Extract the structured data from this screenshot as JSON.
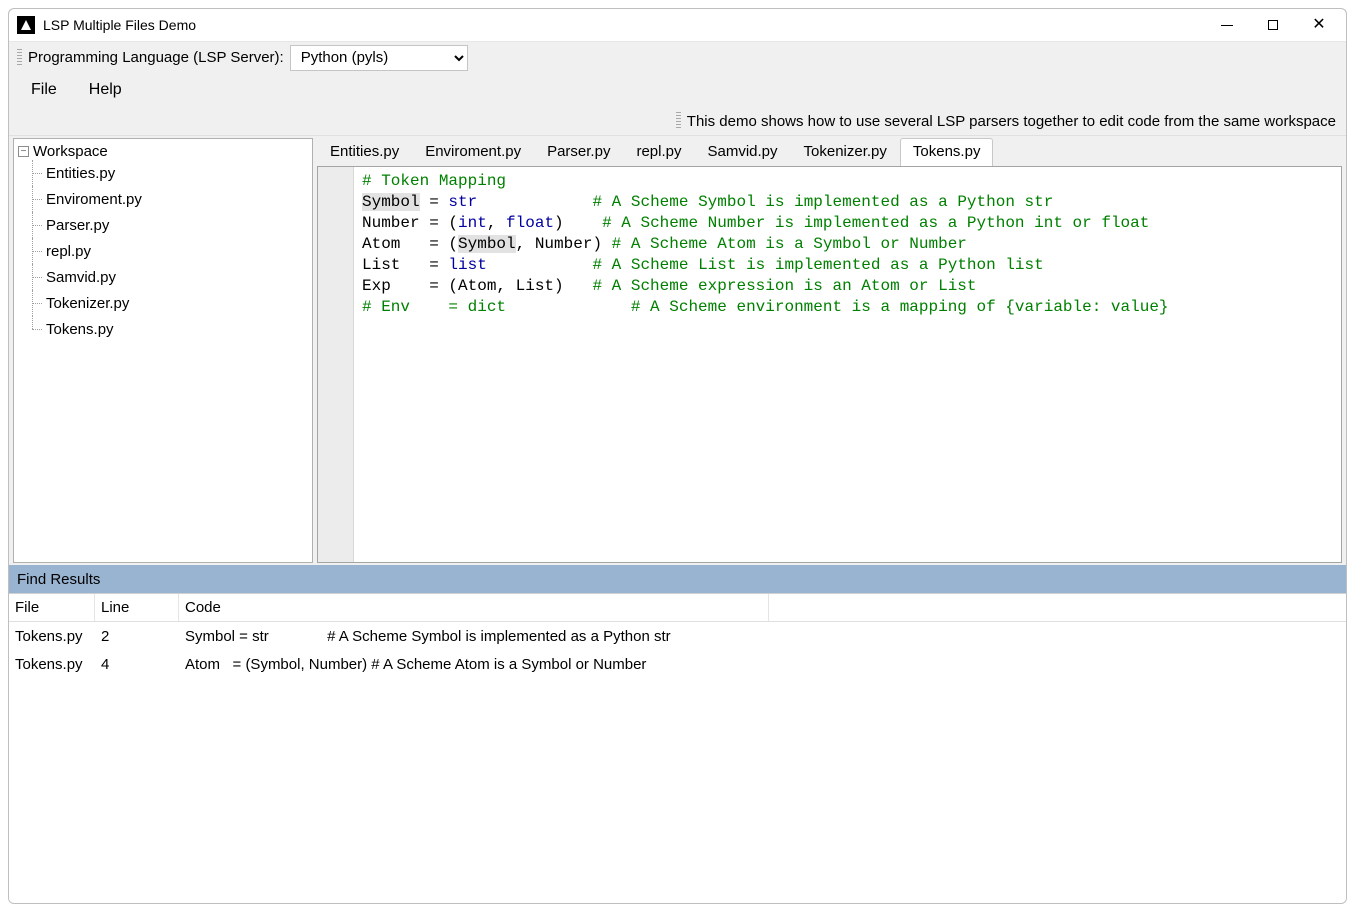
{
  "window": {
    "title": "LSP Multiple Files Demo"
  },
  "toolbar": {
    "label": "Programming Language (LSP Server):",
    "selected": "Python (pyls)"
  },
  "menu": {
    "file": "File",
    "help": "Help"
  },
  "info_text": "This demo shows how to use several LSP parsers together to edit code from the same workspace",
  "workspace": {
    "root": "Workspace",
    "files": [
      "Entities.py",
      "Enviroment.py",
      "Parser.py",
      "repl.py",
      "Samvid.py",
      "Tokenizer.py",
      "Tokens.py"
    ]
  },
  "tabs": [
    "Entities.py",
    "Enviroment.py",
    "Parser.py",
    "repl.py",
    "Samvid.py",
    "Tokenizer.py",
    "Tokens.py"
  ],
  "active_tab": "Tokens.py",
  "code_lines": [
    {
      "t": "comment",
      "text": "# Token Mapping"
    },
    {
      "t": "assign",
      "lhs": "Symbol",
      "hl_lhs": true,
      "op": " = ",
      "rhs_kw": "str",
      "rhs_after": "            ",
      "comment": "# A Scheme Symbol is implemented as a Python str"
    },
    {
      "t": "assign",
      "lhs": "Number",
      "op": " = (",
      "rhs_kw": "int",
      "rhs_after": ", ",
      "rhs_kw2": "float",
      "rhs_after2": ")    ",
      "comment": "# A Scheme Number is implemented as a Python int or float"
    },
    {
      "t": "atom",
      "lhs": "Atom  ",
      " op": " = (",
      "sym": "Symbol",
      "sep": ", Number) ",
      "comment": "# A Scheme Atom is a Symbol or Number"
    },
    {
      "t": "assign",
      "lhs": "List  ",
      "op": " = ",
      "rhs_kw": "list",
      "rhs_after": "           ",
      "comment": "# A Scheme List is implemented as a Python list"
    },
    {
      "t": "plain",
      "lhs": "Exp   ",
      "rhs": " = (Atom, List)   ",
      "comment": "# A Scheme expression is an Atom or List"
    },
    {
      "t": "comment",
      "text": "# Env    = dict             # A Scheme environment is a mapping of {variable: value}"
    }
  ],
  "find": {
    "header": "Find Results",
    "cols": {
      "file": "File",
      "line": "Line",
      "code": "Code"
    },
    "rows": [
      {
        "file": "Tokens.py",
        "line": "2",
        "code": "Symbol = str              # A Scheme Symbol is implemented as a Python str"
      },
      {
        "file": "Tokens.py",
        "line": "4",
        "code": "Atom   = (Symbol, Number) # A Scheme Atom is a Symbol or Number"
      }
    ]
  }
}
